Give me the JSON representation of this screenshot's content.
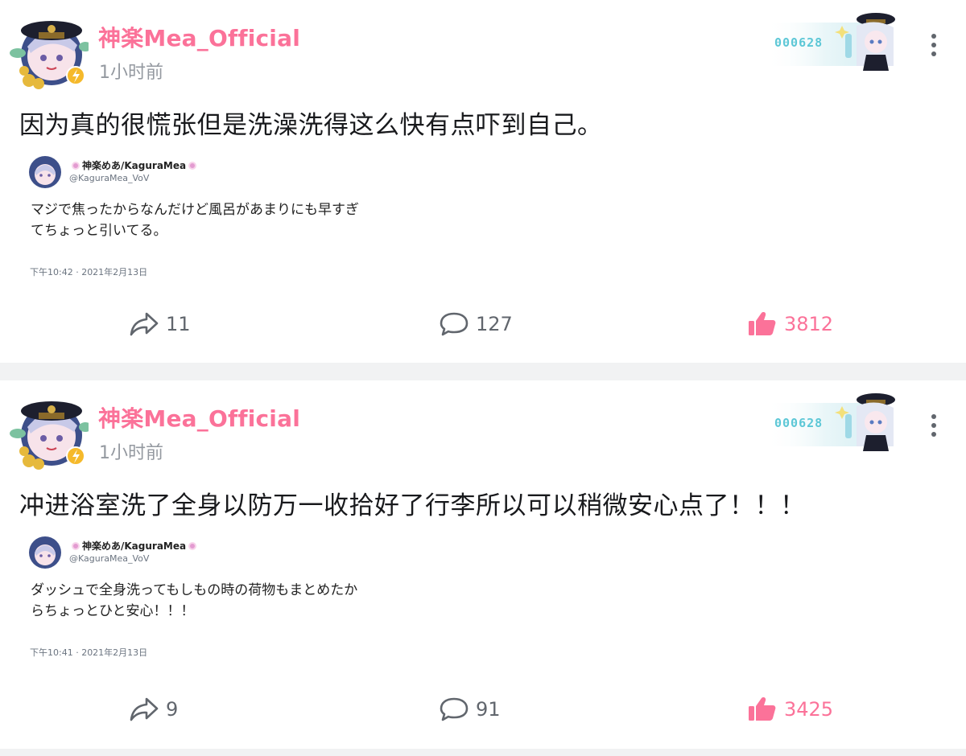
{
  "posts": [
    {
      "username": "神楽Mea_Official",
      "time": "1小时前",
      "fan_badge_number": "000628",
      "text": "因为真的很慌张但是洗澡洗得这么快有点吓到自己。",
      "quote": {
        "display_name": "神楽めあ/KaguraMea",
        "handle": "@KaguraMea_VoV",
        "text": "マジで焦ったからなんだけど風呂があまりにも早すぎ\nてちょっと引いてる。",
        "date": "下午10:42 · 2021年2月13日"
      },
      "shares": "11",
      "comments": "127",
      "likes": "3812"
    },
    {
      "username": "神楽Mea_Official",
      "time": "1小时前",
      "fan_badge_number": "000628",
      "text": "冲进浴室洗了全身以防万一收拾好了行李所以可以稍微安心点了！！！",
      "quote": {
        "display_name": "神楽めあ/KaguraMea",
        "handle": "@KaguraMea_VoV",
        "text": "ダッシュで全身洗ってもしもの時の荷物もまとめたか\nらちょっとひと安心！！！",
        "date": "下午10:41 · 2021年2月13日"
      },
      "shares": "9",
      "comments": "91",
      "likes": "3425"
    }
  ],
  "icons": {
    "share": "share-icon",
    "comment": "comment-icon",
    "like": "thumbs-up-icon",
    "more": "more-vertical-icon"
  },
  "colors": {
    "accent": "#fb7299",
    "secondary_text": "#9499a0",
    "badge_number": "#5cc7d6"
  }
}
